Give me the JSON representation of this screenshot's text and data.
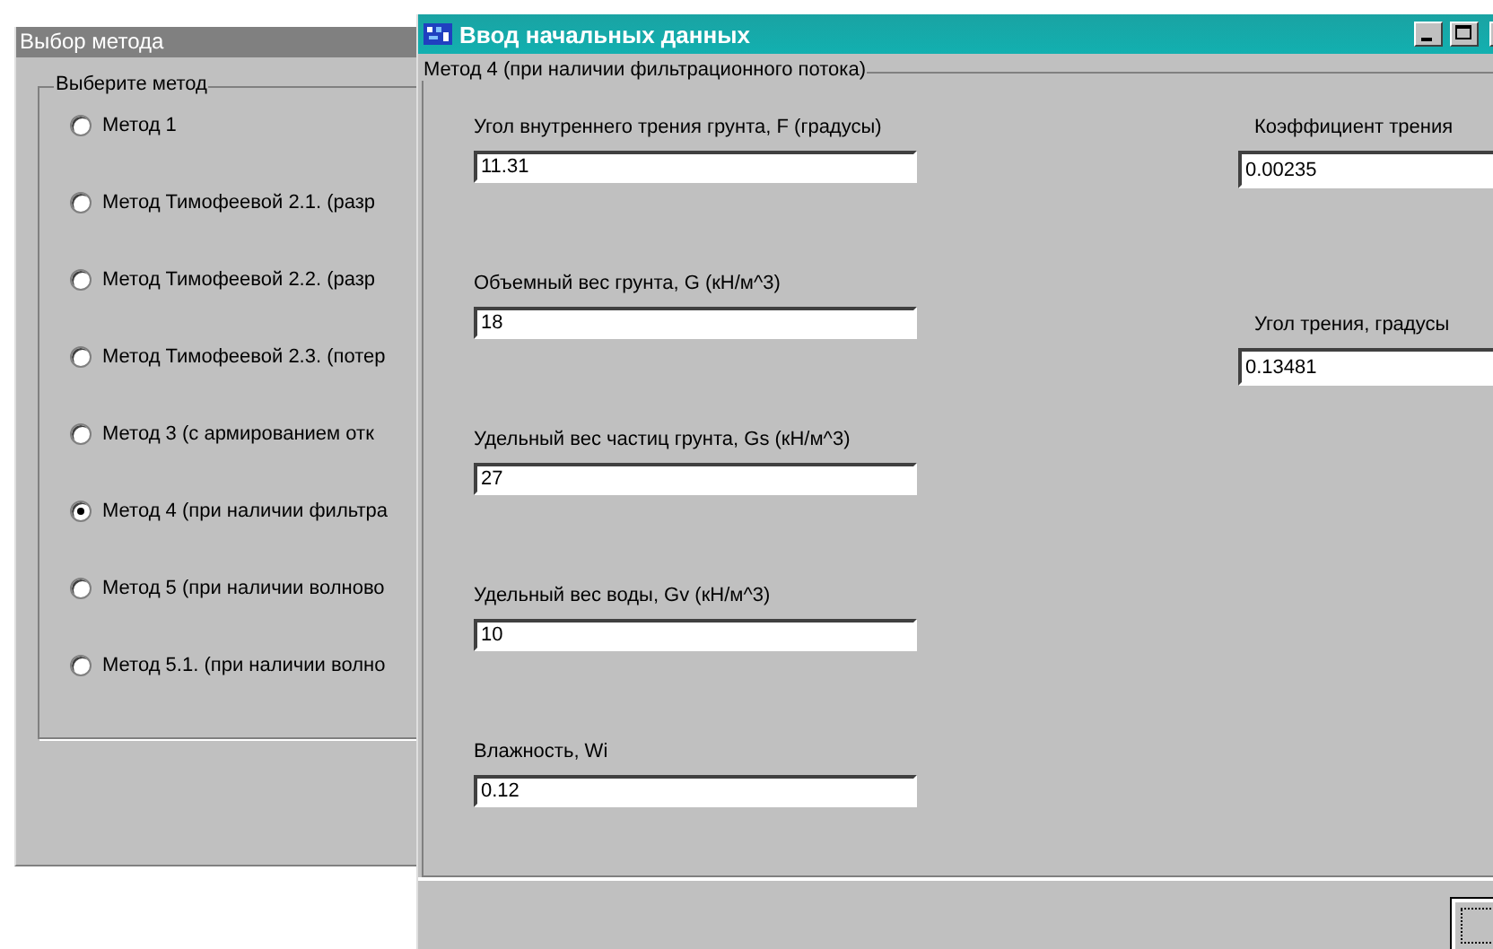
{
  "method_window": {
    "title": "Выбор метода",
    "group_label": "Выберите метод",
    "options": [
      {
        "label": "Метод 1",
        "selected": false
      },
      {
        "label": "Метод Тимофеевой 2.1. (разр",
        "selected": false
      },
      {
        "label": "Метод Тимофеевой 2.2. (разр",
        "selected": false
      },
      {
        "label": "Метод Тимофеевой 2.3. (потер",
        "selected": false
      },
      {
        "label": "Метод 3 (с армированием отк",
        "selected": false
      },
      {
        "label": "Метод 4 (при наличии фильтра",
        "selected": true
      },
      {
        "label": "Метод 5 (при наличии волново",
        "selected": false
      },
      {
        "label": "Метод 5.1. (при наличии волно",
        "selected": false
      }
    ]
  },
  "input_window": {
    "title": "Ввод начальных данных",
    "group_label": "Метод 4 (при наличии фильтрационного потока)",
    "fields": [
      {
        "label": "Угол внутреннего трения грунта, F (градусы)",
        "value": "11.31"
      },
      {
        "label": "Объемный вес грунта, G (кН/м^3)",
        "value": "18"
      },
      {
        "label": "Удельный вес частиц грунта,  Gs (кН/м^3)",
        "value": "27"
      },
      {
        "label": "Удельный вес воды, Gv (кН/м^3)",
        "value": "10"
      },
      {
        "label": "Влажность, Wi",
        "value": "0.12"
      }
    ],
    "side_fields": [
      {
        "label": "Коэффициент трения",
        "value": "0.00235"
      },
      {
        "label": "Угол трения, градусы",
        "value": "0.13481"
      }
    ]
  }
}
